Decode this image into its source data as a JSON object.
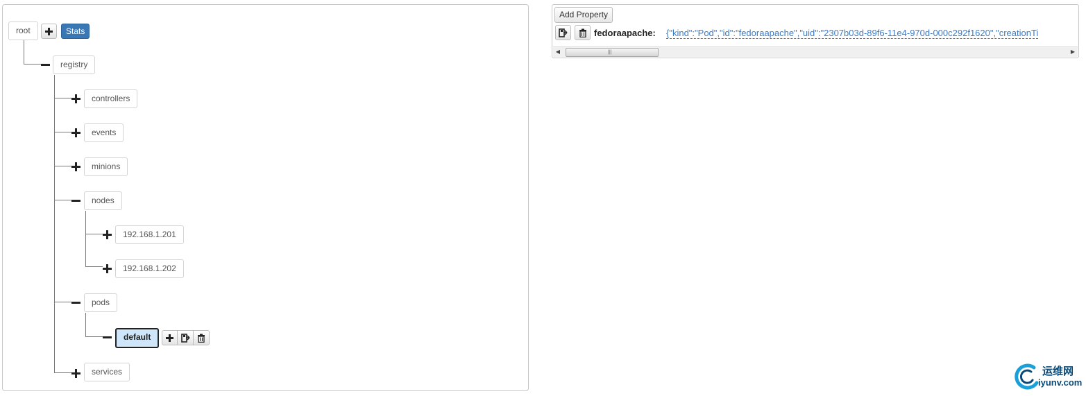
{
  "tree": {
    "root": "root",
    "stats_label": "Stats",
    "registry": "registry",
    "controllers": "controllers",
    "events": "events",
    "minions": "minions",
    "nodes": "nodes",
    "node_1": "192.168.1.201",
    "node_2": "192.168.1.202",
    "pods": "pods",
    "default": "default",
    "services": "services"
  },
  "properties": {
    "add_label": "Add Property",
    "key": "fedoraapache:",
    "value": "{\"kind\":\"Pod\",\"id\":\"fedoraapache\",\"uid\":\"2307b03d-89f6-11e4-970d-000c292f1620\",\"creationTi"
  },
  "watermark": {
    "cn": "运维网",
    "en": "iyunv.com"
  },
  "icons": {
    "add": "plus-icon",
    "save": "save-icon",
    "delete": "trash-icon",
    "left": "arrow-left-icon",
    "right": "arrow-right-icon"
  },
  "colors": {
    "stats_button": "#3a78b5",
    "selected_node": "#cfe6fa",
    "value_link": "#3a7bc8"
  }
}
